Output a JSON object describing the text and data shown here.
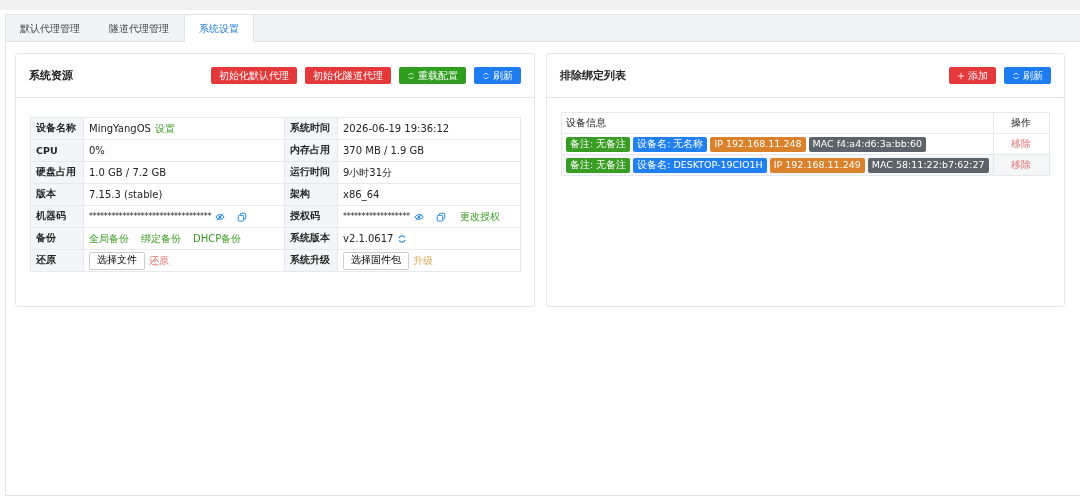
{
  "tabs": [
    {
      "label": "默认代理管理",
      "selected": false
    },
    {
      "label": "隧道代理管理",
      "selected": false
    },
    {
      "label": "系统设置",
      "selected": true
    }
  ],
  "resources": {
    "title": "系统资源",
    "buttons": [
      {
        "label": "初始化默认代理",
        "kind": "danger",
        "icon": false
      },
      {
        "label": "初始化隧道代理",
        "kind": "danger",
        "icon": false
      },
      {
        "label": "重载配置",
        "kind": "success",
        "icon": true
      },
      {
        "label": "刷新",
        "kind": "primary",
        "icon": true
      }
    ],
    "rows": [
      [
        {
          "label": "设备名称",
          "kind": "text",
          "value": "MingYangOS",
          "actions": [
            {
              "label": "设置",
              "kind": "success"
            }
          ]
        },
        {
          "label": "系统时间",
          "kind": "text",
          "value": "2026-06-19 19:36:12"
        }
      ],
      [
        {
          "label": "CPU",
          "kind": "text",
          "value": "0%"
        },
        {
          "label": "内存占用",
          "kind": "text",
          "value": "370 MB / 1.9 GB"
        }
      ],
      [
        {
          "label": "硬盘占用",
          "kind": "text",
          "value": "1.0 GB / 7.2 GB"
        },
        {
          "label": "运行时间",
          "kind": "text",
          "value": "9小时31分"
        }
      ],
      [
        {
          "label": "版本",
          "kind": "text",
          "value": "7.15.3 (stable)"
        },
        {
          "label": "架构",
          "kind": "text",
          "value": "x86_64"
        }
      ],
      [
        {
          "label": "机器码",
          "kind": "masked",
          "value": "*********************************"
        },
        {
          "label": "授权码",
          "kind": "masked",
          "value": "******************",
          "actions": [
            {
              "label": "更改授权",
              "kind": "success"
            }
          ]
        }
      ],
      [
        {
          "label": "备份",
          "kind": "text",
          "actions": [
            {
              "label": "全局备份",
              "kind": "success"
            },
            {
              "label": "绑定备份",
              "kind": "success"
            },
            {
              "label": "DHCP备份",
              "kind": "success"
            }
          ]
        },
        {
          "label": "系统版本",
          "kind": "version",
          "value": "v2.1.0617"
        }
      ],
      [
        {
          "label": "还原",
          "kind": "file",
          "button": "选择文件",
          "actions": [
            {
              "label": "还原",
              "kind": "danger"
            }
          ]
        },
        {
          "label": "系统升级",
          "kind": "file",
          "button": "选择固件包",
          "actions": [
            {
              "label": "升级",
              "kind": "warning"
            }
          ]
        }
      ]
    ]
  },
  "exclusions": {
    "title": "排除绑定列表",
    "buttons": [
      {
        "label": "添加",
        "kind": "danger",
        "icon": true
      },
      {
        "label": "刷新",
        "kind": "primary",
        "icon": true
      }
    ],
    "columns": [
      "设备信息",
      "操作"
    ],
    "rows": [
      {
        "tags": [
          {
            "text": "备注: 无备注",
            "color": "#3a9d23"
          },
          {
            "text": "设备名: 无名称",
            "color": "#2080f0"
          },
          {
            "text": "IP 192.168.11.248",
            "color": "#d9822b"
          },
          {
            "text": "MAC f4:a4:d6:3a:bb:60",
            "color": "#5c636a"
          }
        ],
        "action": "移除"
      },
      {
        "tags": [
          {
            "text": "备注: 无备注",
            "color": "#3a9d23"
          },
          {
            "text": "设备名: DESKTOP-19CIO1H",
            "color": "#2080f0"
          },
          {
            "text": "IP 192.168.11.249",
            "color": "#d9822b"
          },
          {
            "text": "MAC 58:11:22:b7:62:27",
            "color": "#5c636a"
          }
        ],
        "action": "移除"
      }
    ]
  }
}
